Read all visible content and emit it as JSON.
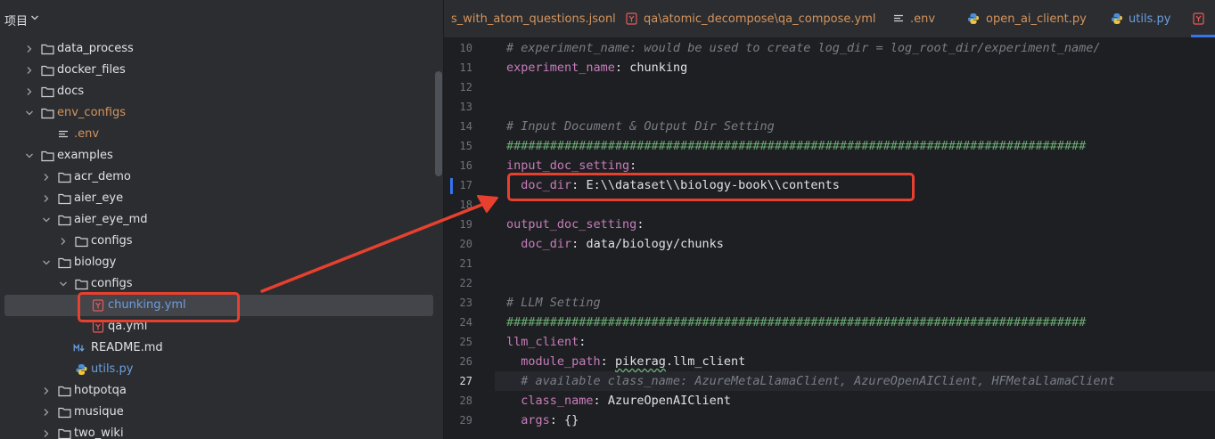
{
  "project_panel": {
    "title": "项目",
    "tree": [
      {
        "label": "data_process"
      },
      {
        "label": "docker_files"
      },
      {
        "label": "docs"
      },
      {
        "label": "env_configs"
      },
      {
        "label": ".env"
      },
      {
        "label": "examples"
      },
      {
        "label": "acr_demo"
      },
      {
        "label": "aier_eye"
      },
      {
        "label": "aier_eye_md"
      },
      {
        "label": "configs"
      },
      {
        "label": "biology"
      },
      {
        "label": "configs"
      },
      {
        "label": "chunking.yml"
      },
      {
        "label": "qa.yml"
      },
      {
        "label": "README.md"
      },
      {
        "label": "utils.py"
      },
      {
        "label": "hotpotqa"
      },
      {
        "label": "musique"
      },
      {
        "label": "two_wiki"
      }
    ]
  },
  "editor": {
    "tabs": [
      {
        "label": "s_with_atom_questions.jsonl"
      },
      {
        "label": "qa\\atomic_decompose\\qa_compose.yml"
      },
      {
        "label": ".env"
      },
      {
        "label": "open_ai_client.py"
      },
      {
        "label": "utils.py"
      }
    ],
    "lines": [
      {
        "num": "10",
        "text": "# experiment_name: would be used to create log_dir = log_root_dir/experiment_name/"
      },
      {
        "num": "11",
        "key": "experiment_name",
        "value": " chunking"
      },
      {
        "num": "12",
        "text": ""
      },
      {
        "num": "13",
        "text": ""
      },
      {
        "num": "14",
        "text": "# Input Document & Output Dir Setting"
      },
      {
        "num": "15",
        "text": "################################################################################"
      },
      {
        "num": "16",
        "key": "input_doc_setting"
      },
      {
        "num": "17",
        "indent": "  ",
        "key": "doc_dir",
        "value": " E:\\\\dataset\\\\biology-book\\\\contents"
      },
      {
        "num": "18",
        "text": ""
      },
      {
        "num": "19",
        "key": "output_doc_setting"
      },
      {
        "num": "20",
        "indent": "  ",
        "key": "doc_dir",
        "value": " data/biology/chunks"
      },
      {
        "num": "21",
        "text": ""
      },
      {
        "num": "22",
        "text": ""
      },
      {
        "num": "23",
        "text": "# LLM Setting"
      },
      {
        "num": "24",
        "text": "################################################################################"
      },
      {
        "num": "25",
        "key": "llm_client"
      },
      {
        "num": "26",
        "indent": "  ",
        "key": "module_path",
        "value_pre": " ",
        "value_squig": "pikerag",
        "value_post": ".llm_client"
      },
      {
        "num": "27",
        "text": "  # available class_name: AzureMetaLlamaClient, AzureOpenAIClient, HFMetaLlamaClient"
      },
      {
        "num": "28",
        "indent": "  ",
        "key": "class_name",
        "value": " AzureOpenAIClient"
      },
      {
        "num": "29",
        "indent": "  ",
        "key": "args",
        "value": " {}"
      }
    ]
  },
  "colors": {
    "highlight": "#e8402e",
    "accent": "#3574f0"
  }
}
